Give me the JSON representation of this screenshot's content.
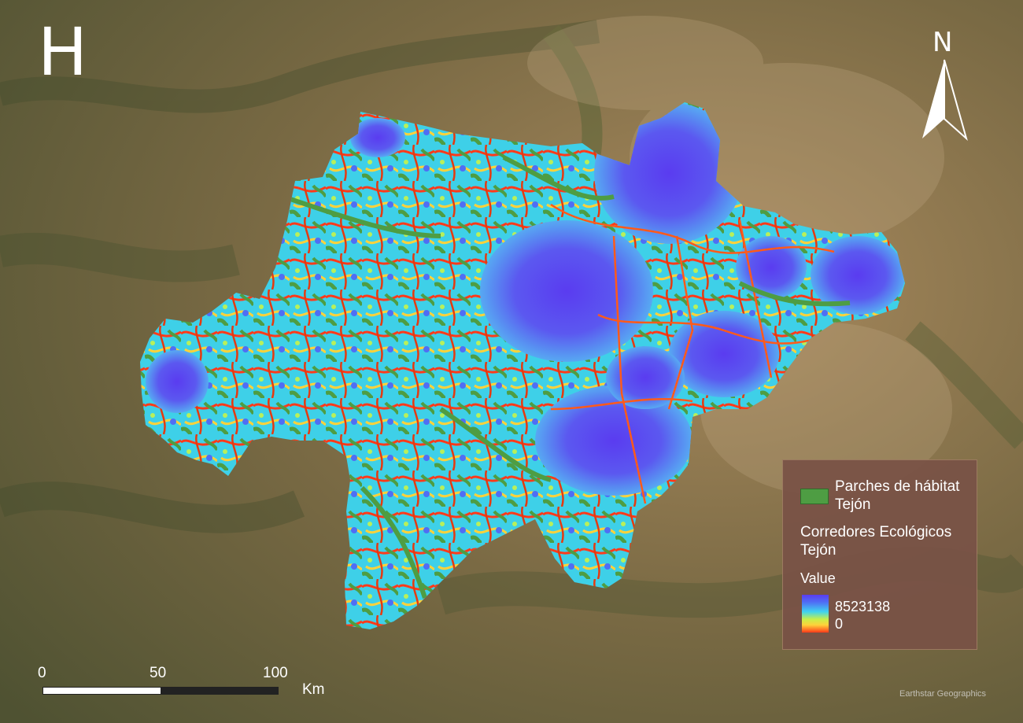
{
  "panel_letter": "H",
  "north_letter": "N",
  "legend": {
    "patch_label": "Parches de hábitat Tejón",
    "corridor_label": "Corredores Ecológicos Tejón",
    "value_label": "Value",
    "max": "8523138",
    "min": "0"
  },
  "scale": {
    "t0": "0",
    "t50": "50",
    "t100": "100",
    "unit": "Km"
  },
  "credit": "Earthstar Geographics",
  "colors": {
    "patch": "#4e9d43",
    "ramp_high": "#5a3cf0",
    "ramp_mid": "#3fd3f0",
    "ramp_low": "#ff3a1a"
  }
}
